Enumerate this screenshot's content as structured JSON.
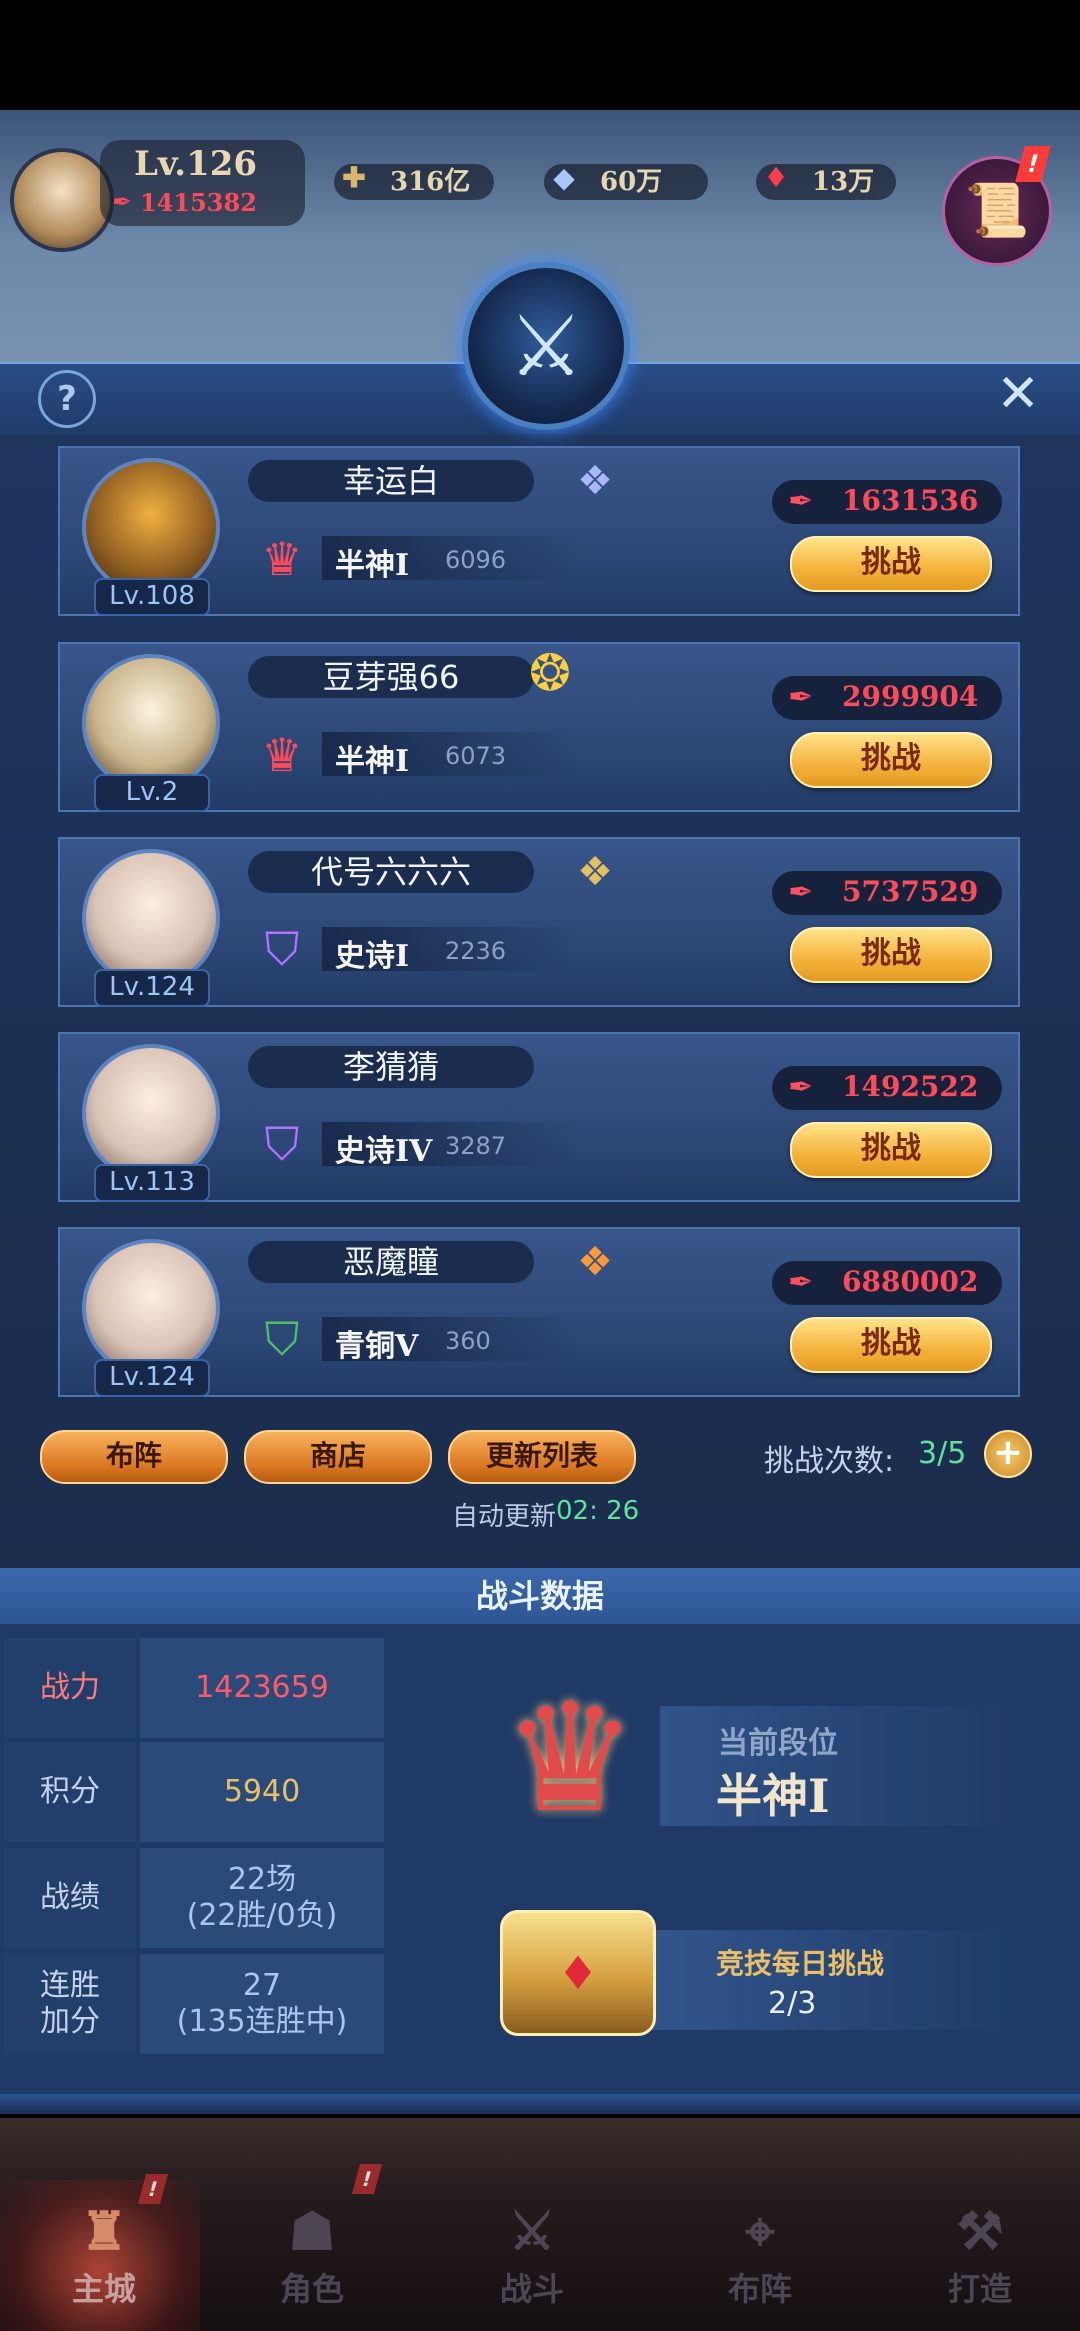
{
  "player": {
    "level": "Lv.126",
    "power": "1415382"
  },
  "currencies": {
    "gold": "316亿",
    "diamond": "60万",
    "ruby": "13万"
  },
  "challengers": [
    {
      "name": "幸运白",
      "level": "Lv.108",
      "rank": "半神I",
      "score": "6096",
      "power": "1631536",
      "button": "挑战",
      "badge": "1"
    },
    {
      "name": "豆芽强66",
      "level": "Lv.2",
      "rank": "半神I",
      "score": "6073",
      "power": "2999904",
      "button": "挑战",
      "badge": "12"
    },
    {
      "name": "代号六六六",
      "level": "Lv.124",
      "rank": "史诗I",
      "score": "2236",
      "power": "5737529",
      "button": "挑战",
      "badge": "6"
    },
    {
      "name": "李猜猜",
      "level": "Lv.113",
      "rank": "史诗IV",
      "score": "3287",
      "power": "1492522",
      "button": "挑战",
      "badge": ""
    },
    {
      "name": "恶魔瞳",
      "level": "Lv.124",
      "rank": "青铜V",
      "score": "360",
      "power": "6880002",
      "button": "挑战",
      "badge": ""
    }
  ],
  "actions": {
    "formation": "布阵",
    "shop": "商店",
    "refresh": "更新列表",
    "attempts_label": "挑战次数:",
    "attempts_value": "3/5",
    "auto_refresh_label": "自动更新",
    "auto_refresh_time": "02: 26"
  },
  "battle_data": {
    "title": "战斗数据",
    "rows": [
      {
        "key": "战力",
        "value": "1423659",
        "sub": ""
      },
      {
        "key": "积分",
        "value": "5940",
        "sub": ""
      },
      {
        "key": "战绩",
        "value": "22场",
        "sub": "(22胜/0负)"
      },
      {
        "key": "连胜加分",
        "value": "27",
        "sub": "(135连胜中)"
      }
    ],
    "current_rank_label": "当前段位",
    "current_rank": "半神I",
    "daily_label": "竞技每日挑战",
    "daily_value": "2/3"
  },
  "nav": {
    "items": [
      "主城",
      "角色",
      "战斗",
      "布阵",
      "打造"
    ]
  },
  "colors": {
    "power_red": "#ff4a5a",
    "attempts_green": "#5fe39a",
    "gold_text": "#e9c067"
  }
}
